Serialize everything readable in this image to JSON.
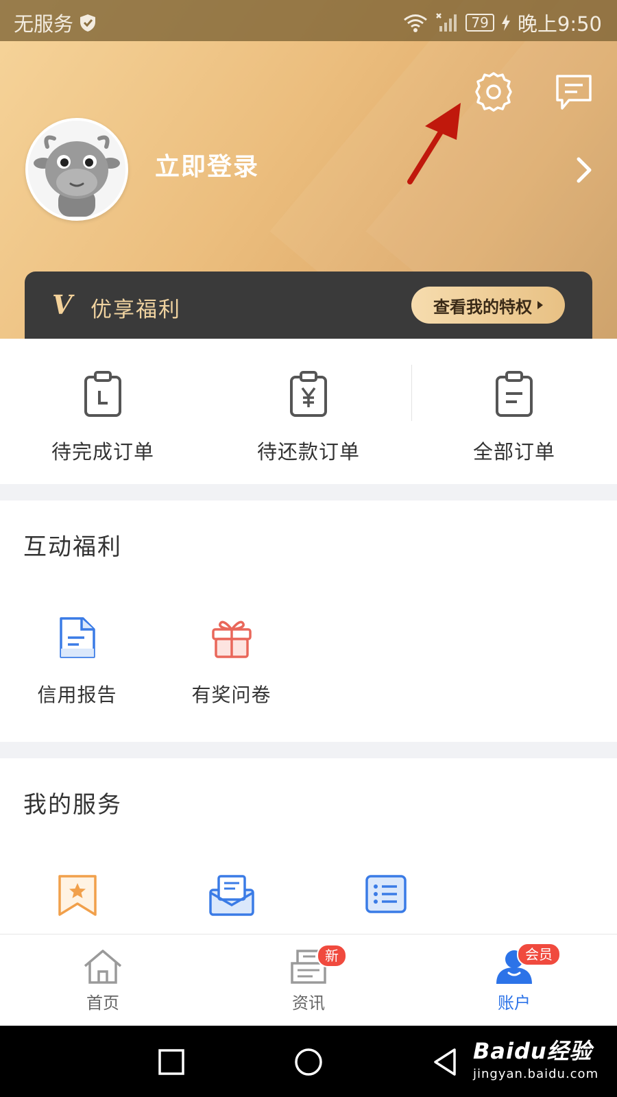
{
  "status_bar": {
    "carrier": "无服务",
    "battery": "79",
    "time": "晚上9:50"
  },
  "profile": {
    "login_label": "立即登录"
  },
  "vip": {
    "badge": "V",
    "title": "优享福利",
    "button_label": "查看我的特权"
  },
  "orders": [
    {
      "label": "待完成订单",
      "icon": "clipboard-l-icon"
    },
    {
      "label": "待还款订单",
      "icon": "clipboard-yen-icon"
    },
    {
      "label": "全部订单",
      "icon": "clipboard-list-icon"
    }
  ],
  "interactive_benefits": {
    "title": "互动福利",
    "items": [
      {
        "label": "信用报告",
        "icon": "document-icon"
      },
      {
        "label": "有奖问卷",
        "icon": "gift-icon"
      }
    ]
  },
  "my_services": {
    "title": "我的服务",
    "items": [
      {
        "label": "",
        "icon": "bookmark-star-icon"
      },
      {
        "label": "",
        "icon": "mail-icon"
      },
      {
        "label": "",
        "icon": "list-icon"
      }
    ]
  },
  "tabbar": {
    "tabs": [
      {
        "label": "首页",
        "icon": "home-icon",
        "active": false
      },
      {
        "label": "资讯",
        "icon": "news-icon",
        "active": false,
        "badge": "新"
      },
      {
        "label": "账户",
        "icon": "account-icon",
        "active": true,
        "badge": "会员"
      }
    ]
  },
  "watermark": {
    "main": "Baidu经验",
    "sub": "jingyan.baidu.com"
  },
  "colors": {
    "header_gold": "#e8bb7c",
    "vip_card": "#3a3a3a",
    "accent_blue": "#2c73e8",
    "badge_red": "#f04a3e",
    "annotation_red": "#c0180c"
  }
}
